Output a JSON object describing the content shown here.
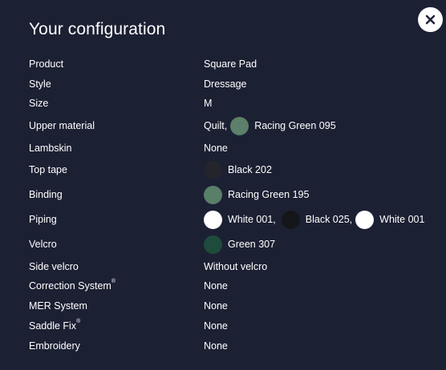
{
  "dialog": {
    "title": "Your configuration",
    "close_icon": "close-icon"
  },
  "rows": {
    "product": {
      "label": "Product",
      "value": "Square Pad"
    },
    "style": {
      "label": "Style",
      "value": "Dressage"
    },
    "size": {
      "label": "Size",
      "value": "M"
    },
    "upper_material": {
      "label": "Upper material",
      "prefix": "Quilt,",
      "color_name": "Racing Green 095",
      "color": "#5c806a"
    },
    "lambskin": {
      "label": "Lambskin",
      "value": "None"
    },
    "top_tape": {
      "label": "Top tape",
      "color_name": "Black 202",
      "color": "#24252c"
    },
    "binding": {
      "label": "Binding",
      "color_name": "Racing Green 195",
      "color": "#5a7f68"
    },
    "piping": {
      "label": "Piping",
      "items": [
        {
          "color_name": "White 001,",
          "color": "#ffffff"
        },
        {
          "color_name": "Black 025,",
          "color": "#15161a"
        },
        {
          "color_name": "White 001",
          "color": "#ffffff"
        }
      ]
    },
    "velcro": {
      "label": "Velcro",
      "color_name": "Green 307",
      "color": "#1f4b3c"
    },
    "side_velcro": {
      "label": "Side velcro",
      "value": "Without velcro"
    },
    "correction_system": {
      "label": "Correction System",
      "mark": "®",
      "value": "None"
    },
    "mer_system": {
      "label": "MER System",
      "value": "None"
    },
    "saddle_fix": {
      "label": "Saddle Fix",
      "mark": "®",
      "value": "None"
    },
    "embroidery": {
      "label": "Embroidery",
      "value": "None"
    }
  }
}
